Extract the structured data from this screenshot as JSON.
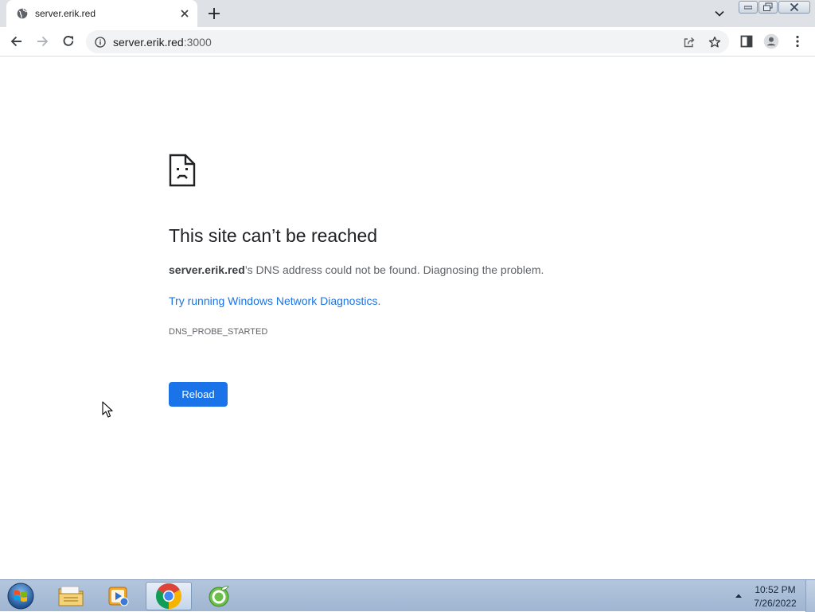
{
  "browser": {
    "tab": {
      "title": "server.erik.red",
      "favicon": "globe-icon"
    },
    "omnibox": {
      "host": "server.erik.red",
      "port": ":3000"
    }
  },
  "error_page": {
    "heading": "This site can’t be reached",
    "host": "server.erik.red",
    "description_suffix": "’s DNS address could not be found. Diagnosing the problem.",
    "suggestion_link": "Try running Windows Network Diagnostics",
    "suggestion_suffix": ".",
    "error_code": "DNS_PROBE_STARTED",
    "reload_label": "Reload"
  },
  "taskbar": {
    "apps": [
      "folder-icon",
      "media-player-icon",
      "chrome-icon",
      "app-green-icon"
    ],
    "active_app": "chrome-icon",
    "clock_time": "10:52 PM",
    "clock_date": "7/26/2022"
  },
  "colors": {
    "accent": "#1a73e8",
    "tabstrip": "#dee1e6",
    "omnibox": "#f1f3f4",
    "taskbar": "#a9bdd6"
  }
}
